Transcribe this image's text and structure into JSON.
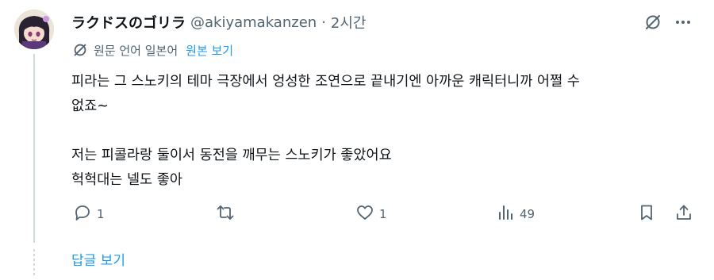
{
  "tweet": {
    "display_name": "ラクドスのゴリラ",
    "handle": "@akiyamakanzen",
    "separator": "·",
    "time": "2시간",
    "translation": {
      "lang_label": "원문 언어 일본어",
      "show_original": "원본 보기"
    },
    "lines": [
      "피라는 그 스노키의 테마 극장에서 엉성한 조연으로 끝내기엔 아까운 캐릭터니까 어쩔 수",
      "없죠~",
      "",
      "저는 피콜라랑 둘이서 동전을 깨무는 스노키가 좋았어요",
      "헉헉대는 넬도 좋아"
    ],
    "metrics": {
      "replies": "1",
      "retweets": "",
      "likes": "1",
      "views": "49"
    }
  },
  "show_replies": "답글 보기",
  "icons": {
    "grok": "grok-icon",
    "more": "more-icon",
    "translate": "translate-icon",
    "reply": "reply-icon",
    "retweet": "retweet-icon",
    "like": "heart-icon",
    "views": "views-icon",
    "bookmark": "bookmark-icon",
    "share": "share-icon"
  },
  "colors": {
    "text": "#0f1419",
    "secondary": "#536471",
    "link": "#1d9bf0",
    "thread_line": "#cfd9de"
  }
}
